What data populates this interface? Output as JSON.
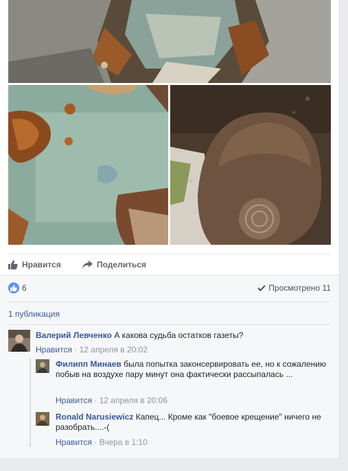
{
  "actions": {
    "like_label": "Нравится",
    "share_label": "Поделиться"
  },
  "reactions": {
    "count": "6",
    "seen_label": "Просмотрено 11"
  },
  "shares_label": "1 публикация",
  "comments": [
    {
      "author": "Валерий Левченко",
      "text": "А какова судьба остатков газеты?",
      "like": "Нравится",
      "sep": " · ",
      "time": "12 апреля в 20:02"
    },
    {
      "author": "Филипп Минаев",
      "text": "была попытка законсервировать ее, но к сожалению побыв на воздухе пару минут она фактически рассыпалась ...",
      "like": "Нравится",
      "sep": " · ",
      "time": "12 апреля в 20:06"
    },
    {
      "author": "Ronald Narusiewicz",
      "text": "Капец... Кроме как \"боевое крещение\" ничего не разобрать....-(",
      "like": "Нравится",
      "sep": " · ",
      "time": "Вчера в 1:10"
    }
  ],
  "icons": {
    "like": "thumbs-up-icon",
    "share": "share-arrow-icon",
    "seen": "checkmark-icon"
  },
  "colors": {
    "link": "#385898",
    "like_badge": "#5890ff",
    "muted": "#90949c"
  }
}
